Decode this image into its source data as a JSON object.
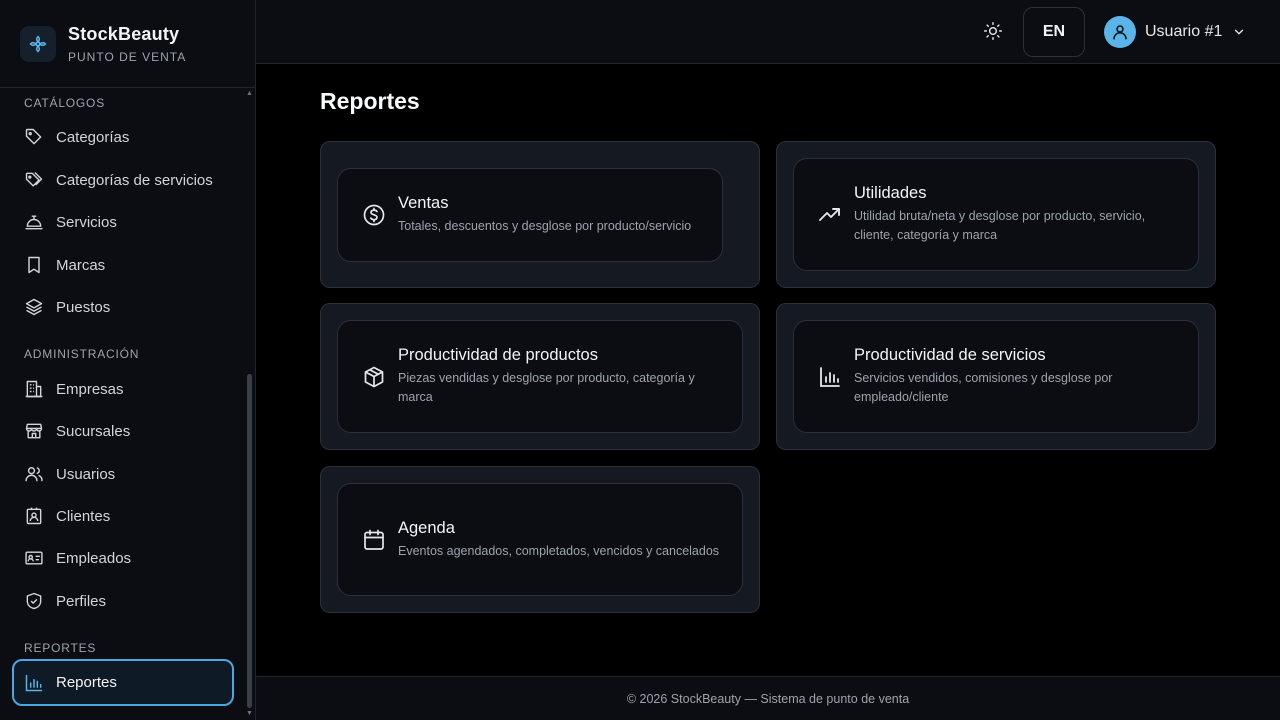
{
  "brand": {
    "name": "StockBeauty",
    "subtitle": "PUNTO DE VENTA",
    "icon": "flower-icon"
  },
  "sidebar": {
    "sections": [
      {
        "title": "CATÁLOGOS"
      },
      {
        "title": "ADMINISTRACIÓN"
      },
      {
        "title": "REPORTES"
      }
    ],
    "items": [
      {
        "label": "Categorías",
        "icon": "tag-icon"
      },
      {
        "label": "Categorías de servicios",
        "icon": "tags-icon"
      },
      {
        "label": "Servicios",
        "icon": "bell-service-icon"
      },
      {
        "label": "Marcas",
        "icon": "bookmark-icon"
      },
      {
        "label": "Puestos",
        "icon": "layers-icon"
      },
      {
        "label": "Empresas",
        "icon": "building-icon"
      },
      {
        "label": "Sucursales",
        "icon": "store-icon"
      },
      {
        "label": "Usuarios",
        "icon": "users-icon"
      },
      {
        "label": "Clientes",
        "icon": "contact-icon"
      },
      {
        "label": "Empleados",
        "icon": "id-card-icon"
      },
      {
        "label": "Perfiles",
        "icon": "shield-check-icon"
      },
      {
        "label": "Reportes",
        "icon": "bar-chart-icon",
        "active": true
      }
    ]
  },
  "header": {
    "language": "EN",
    "user_name": "Usuario #1",
    "theme_icon": "sun-icon"
  },
  "main": {
    "title": "Reportes",
    "cards": [
      {
        "title": "Ventas",
        "description": "Totales, descuentos y desglose por producto/servicio",
        "icon": "dollar-circle-icon"
      },
      {
        "title": "Utilidades",
        "description": "Utilidad bruta/neta y desglose por producto, servicio, cliente, categoría y marca",
        "icon": "trending-up-icon"
      },
      {
        "title": "Productividad de productos",
        "description": "Piezas vendidas y desglose por producto, categoría y marca",
        "icon": "package-icon"
      },
      {
        "title": "Productividad de servicios",
        "description": "Servicios vendidos, comisiones y desglose por empleado/cliente",
        "icon": "bar-chart-icon"
      },
      {
        "title": "Agenda",
        "description": "Eventos agendados, completados, vencidos y cancelados",
        "icon": "calendar-icon"
      }
    ]
  },
  "footer": {
    "text": "© 2026 StockBeauty — Sistema de punto de venta"
  },
  "colors": {
    "accent": "#4aa8e0",
    "avatar": "#5ab4e8",
    "background": "#000000",
    "card": "#151922"
  }
}
